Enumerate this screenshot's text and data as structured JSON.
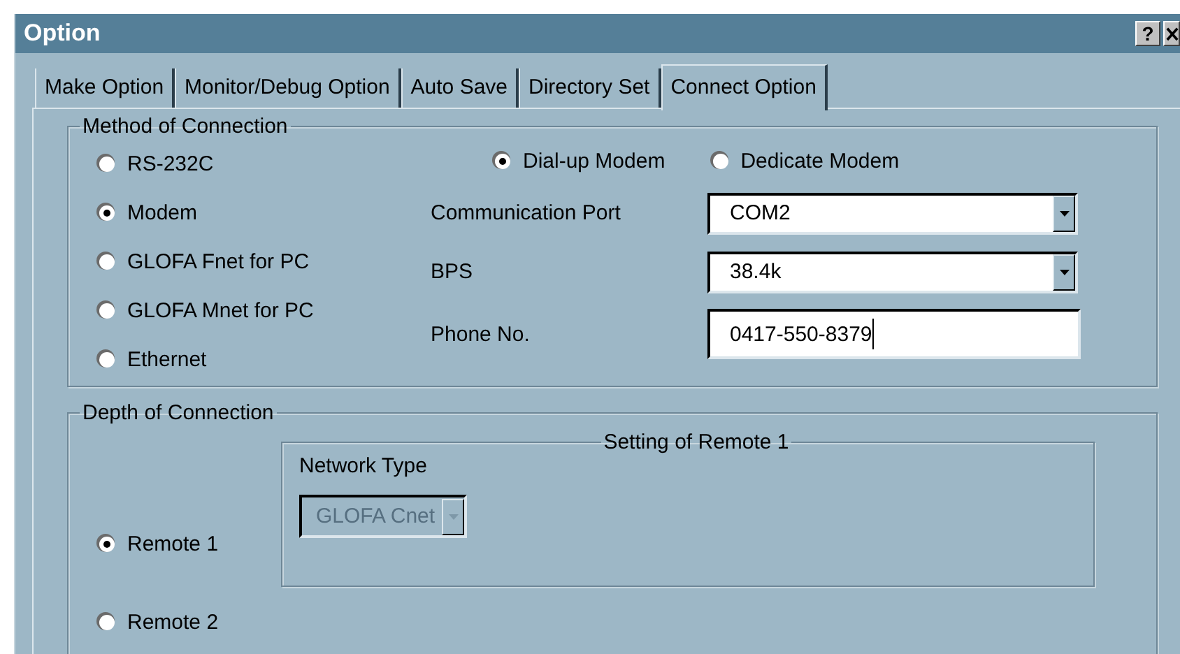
{
  "window": {
    "title": "Option",
    "help_button": "?"
  },
  "tabs": [
    {
      "label": "Make Option",
      "selected": false
    },
    {
      "label": "Monitor/Debug Option",
      "selected": false
    },
    {
      "label": "Auto Save",
      "selected": false
    },
    {
      "label": "Directory Set",
      "selected": false
    },
    {
      "label": "Connect Option",
      "selected": true
    }
  ],
  "method_of_connection": {
    "title": "Method of Connection",
    "options": [
      {
        "label": "RS-232C",
        "selected": false
      },
      {
        "label": "Modem",
        "selected": true
      },
      {
        "label": "GLOFA Fnet for PC",
        "selected": false
      },
      {
        "label": "GLOFA Mnet for PC",
        "selected": false
      },
      {
        "label": "Ethernet",
        "selected": false
      }
    ],
    "modem_types": [
      {
        "label": "Dial-up Modem",
        "selected": true
      },
      {
        "label": "Dedicate Modem",
        "selected": false
      }
    ],
    "fields": [
      {
        "label": "Communication Port",
        "value": "COM2",
        "kind": "dropdown"
      },
      {
        "label": "BPS",
        "value": "38.4k",
        "kind": "dropdown"
      },
      {
        "label": "Phone No.",
        "value": "0417-550-8379",
        "kind": "text"
      }
    ]
  },
  "depth_of_connection": {
    "title": "Depth of Connection",
    "options": [
      {
        "label": "Remote 1",
        "selected": true
      },
      {
        "label": "Remote 2",
        "selected": false
      }
    ],
    "remote_settings": {
      "title": "Setting of Remote 1",
      "network_type_label": "Network Type",
      "network_type": "GLOFA Cnet",
      "disabled": true
    }
  }
}
